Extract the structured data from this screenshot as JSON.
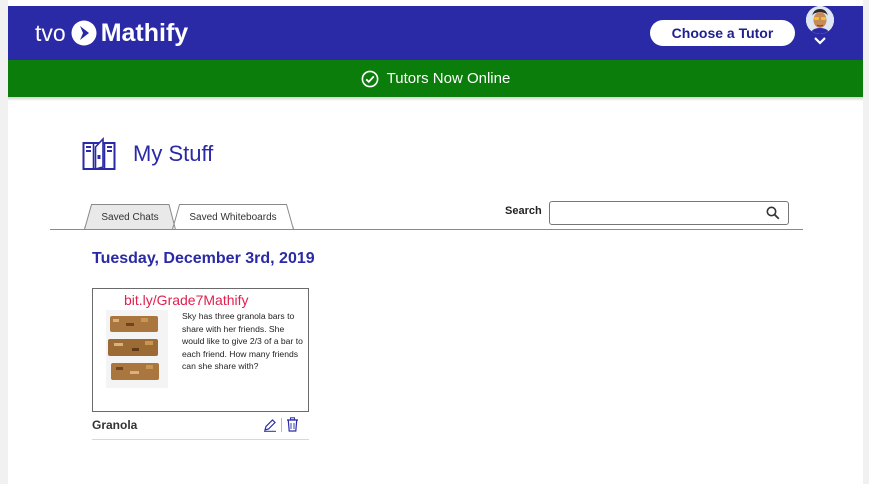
{
  "header": {
    "logo_tvo": "tvo",
    "logo_mathify": "Mathify",
    "choose_tutor_label": "Choose a Tutor"
  },
  "banner": {
    "status_text": "Tutors Now Online"
  },
  "page": {
    "title": "My Stuff"
  },
  "tabs": [
    {
      "label": "Saved Chats",
      "active": false
    },
    {
      "label": "Saved Whiteboards",
      "active": true
    }
  ],
  "search": {
    "label": "Search",
    "value": "",
    "placeholder": ""
  },
  "date_heading": "Tuesday, December 3rd, 2019",
  "whiteboards": [
    {
      "link_text": "bit.ly/Grade7Mathify",
      "problem_text": "Sky has three granola bars to share with her friends. She would like to give 2/3 of a bar to each friend. How many friends can she share with?",
      "name": "Granola"
    }
  ],
  "colors": {
    "header_bg": "#2a2aa6",
    "banner_bg": "#0b7d0b",
    "title": "#2a2aa6",
    "link": "#e0204f"
  },
  "icons": [
    "tvo-arrow-icon",
    "avatar",
    "chevron-down-icon",
    "check-circle-icon",
    "lockers-icon",
    "search-icon",
    "pencil-icon",
    "trash-icon"
  ]
}
